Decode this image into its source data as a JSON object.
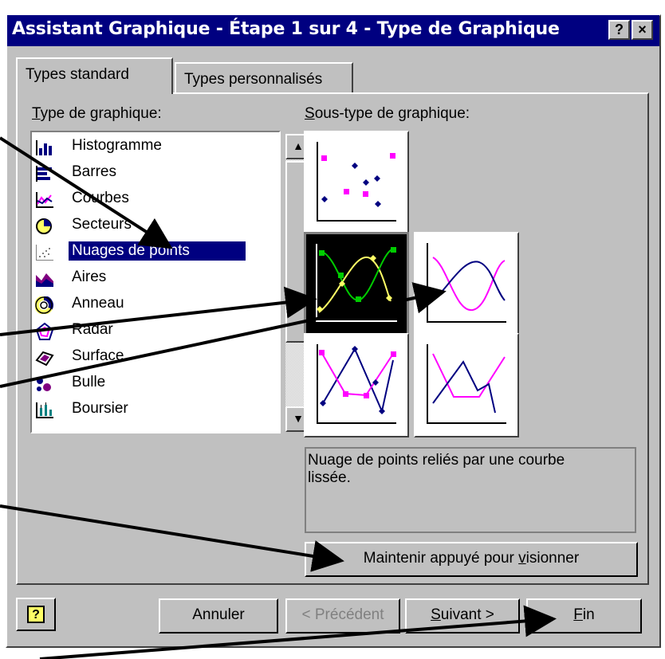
{
  "window": {
    "title": "Assistant Graphique - Étape 1 sur 4 - Type de Graphique",
    "help_button": "?",
    "close_button": "×"
  },
  "tabs": [
    {
      "label": "Types standard",
      "active": true
    },
    {
      "label": "Types personnalisés",
      "active": false
    }
  ],
  "chart_type": {
    "label_first": "T",
    "label_rest": "ype de graphique:",
    "items": [
      {
        "label": "Histogramme",
        "icon": "column-chart-icon"
      },
      {
        "label": "Barres",
        "icon": "bar-chart-icon"
      },
      {
        "label": "Courbes",
        "icon": "line-chart-icon"
      },
      {
        "label": "Secteurs",
        "icon": "pie-chart-icon"
      },
      {
        "label": "Nuages de points",
        "icon": "scatter-chart-icon",
        "selected": true
      },
      {
        "label": "Aires",
        "icon": "area-chart-icon"
      },
      {
        "label": "Anneau",
        "icon": "doughnut-chart-icon"
      },
      {
        "label": "Radar",
        "icon": "radar-chart-icon"
      },
      {
        "label": "Surface",
        "icon": "surface-chart-icon"
      },
      {
        "label": "Bulle",
        "icon": "bubble-chart-icon"
      },
      {
        "label": "Boursier",
        "icon": "stock-chart-icon"
      }
    ]
  },
  "subtype": {
    "label_first": "S",
    "label_rest": "ous-type de graphique:",
    "selected_index": 1
  },
  "description": "Nuage de points reliés par une courbe lissée.",
  "preview_button": {
    "before": "Maintenir appuyé pour ",
    "underlined": "v",
    "after": "isionner"
  },
  "buttons": {
    "help": "?",
    "cancel": "Annuler",
    "previous": "< Précédent",
    "next_underlined": "S",
    "next_rest": "uivant >",
    "finish_underlined": "F",
    "finish_rest": "in"
  },
  "colors": {
    "titlebar": "#000080",
    "face": "#c0c0c0",
    "selection": "#000080",
    "series_magenta": "#ff00ff",
    "series_navy": "#000080",
    "subtype_yellow": "#ffff66",
    "subtype_green": "#00cc00"
  }
}
